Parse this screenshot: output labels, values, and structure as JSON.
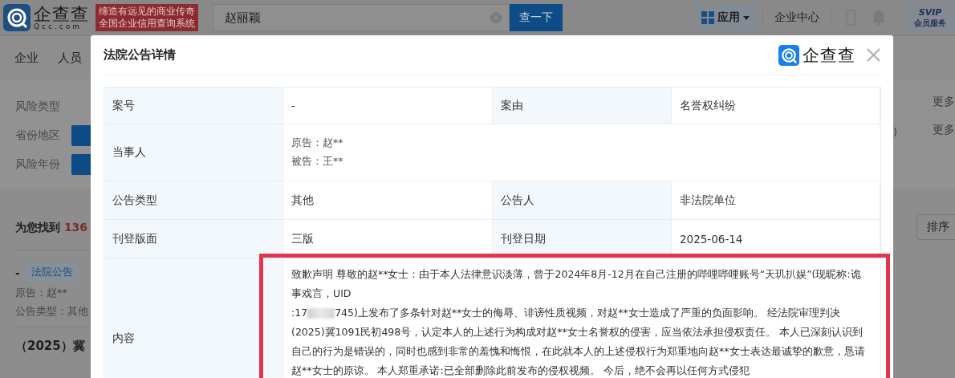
{
  "header": {
    "logo_text": "企查查",
    "logo_domain": "Qcc.com",
    "slogan": [
      "缔造有远见的商业传奇",
      "全国企业信用查询系统"
    ],
    "search": {
      "value": "赵丽颖"
    },
    "search_button": "查一下",
    "apps_menu": "应用",
    "enterprise_center": "企业中心",
    "vip": {
      "title": "SVIP",
      "subtitle": "会员服务"
    }
  },
  "nav": [
    "企业",
    "人员"
  ],
  "filters": [
    {
      "label": "风险类型",
      "selected": false
    },
    {
      "label": "省份地区",
      "selected": true
    },
    {
      "label": "风险年份",
      "selected": true
    }
  ],
  "more_links": [
    "更多",
    "更多"
  ],
  "right_fragment": ")",
  "results": {
    "prefix": "为您找到",
    "count": "136",
    "sort_button": "排序"
  },
  "result_item": {
    "dash": "-",
    "tag": "法院公告",
    "party": "原告：赵**",
    "type": "公告类型：其他"
  },
  "next_title": "（2025）冀",
  "modal": {
    "title": "法院公告详情",
    "brand": "企查查",
    "rows": [
      {
        "kind": "pair",
        "cells": [
          "案号",
          "-",
          "案由",
          "名誉权纠纷"
        ]
      },
      {
        "kind": "multiline",
        "label": "当事人",
        "lines": [
          "原告：赵**",
          "被告：王**"
        ]
      },
      {
        "kind": "pair",
        "cells": [
          "公告类型",
          "其他",
          "公告人",
          "非法院单位"
        ]
      },
      {
        "kind": "pair",
        "cells": [
          "刊登版面",
          "三版",
          "刊登日期",
          "2025-06-14"
        ]
      },
      {
        "kind": "content",
        "label": "内容",
        "highlighted": true,
        "before": "致歉声明 尊敬的赵**女士：由于本人法律意识淡薄，曾于2024年8月-12月在自己注册的哔哩哔哩账号“天玑扒娱”(现昵称:诡事戏言，UID",
        "uid_start": ":17",
        "after": "745)上发布了多条针对赵**女士的侮辱、诽谤性质视频，对赵**女士造成了严重的负面影响。 经法院审理判决(2025)冀1091民初498号，认定本人的上述行为构成对赵**女士名誉权的侵害，应当依法承担侵权责任。 本人已深刻认识到自己的行为是错误的，同时也感到非常的羞愧和悔恨，在此就本人的上述侵权行为郑重地向赵**女士表达最诚挚的歉意，恳请赵**女士的原谅。 本人郑重承诺:已全部删除此前发布的侵权视频。 今后，绝不会再以任何方式侵犯"
      }
    ]
  }
}
